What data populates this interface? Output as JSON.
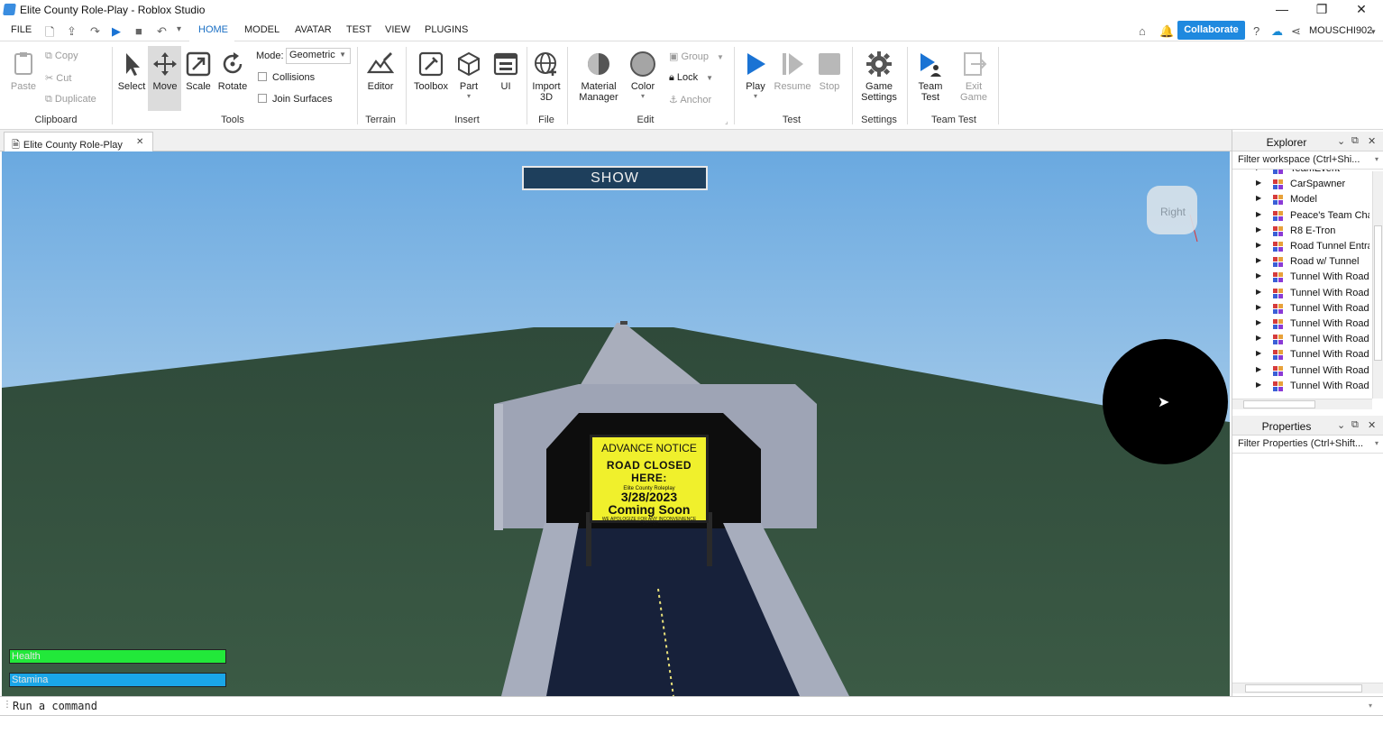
{
  "window": {
    "title": "Elite County Role-Play - Roblox Studio",
    "controls": [
      "—",
      "❐",
      "✕"
    ]
  },
  "menu": {
    "tabs": [
      "FILE",
      "HOME",
      "MODEL",
      "AVATAR",
      "TEST",
      "VIEW",
      "PLUGINS"
    ],
    "active_tab": "HOME",
    "collaborate": "Collaborate",
    "username": "MOUSCHI902"
  },
  "ribbon": {
    "clipboard": {
      "paste": "Paste",
      "copy": "Copy",
      "cut": "Cut",
      "duplicate": "Duplicate",
      "label": "Clipboard"
    },
    "tools": {
      "select": "Select",
      "move": "Move",
      "scale": "Scale",
      "rotate": "Rotate",
      "mode_label": "Mode:",
      "mode_value": "Geometric",
      "collisions": "Collisions",
      "join_surfaces": "Join Surfaces",
      "label": "Tools"
    },
    "terrain": {
      "editor": "Editor",
      "label": "Terrain"
    },
    "insert": {
      "toolbox": "Toolbox",
      "part": "Part",
      "ui": "UI",
      "label": "Insert"
    },
    "file": {
      "import_line1": "Import",
      "import_line2": "3D",
      "label": "File"
    },
    "edit": {
      "material_line1": "Material",
      "material_line2": "Manager",
      "color": "Color",
      "group": "Group",
      "lock": "Lock",
      "anchor": "Anchor",
      "label": "Edit"
    },
    "test": {
      "play": "Play",
      "resume": "Resume",
      "stop": "Stop",
      "label": "Test"
    },
    "settings": {
      "game_line1": "Game",
      "game_line2": "Settings",
      "label": "Settings"
    },
    "teamtest": {
      "team_line1": "Team",
      "team_line2": "Test",
      "exit_line1": "Exit",
      "exit_line2": "Game",
      "label": "Team Test"
    }
  },
  "doc_tab": {
    "label": "Elite County Role-Play",
    "close": "✕"
  },
  "viewport": {
    "show_button": "SHOW",
    "view_cube_label": "Right",
    "health_label": "Health",
    "stamina_label": "Stamina",
    "health_color": "#22e83a",
    "stamina_color": "#1aa6e8",
    "sign": {
      "line1": "ADVANCE NOTICE",
      "line2": "ROAD CLOSED HERE:",
      "line3": "Elite County Roleplay",
      "line4": "3/28/2023",
      "line5": "Coming Soon",
      "line6": "WE APOLOGIZE FOR ANY INCONVENIENCE CAUSED"
    }
  },
  "command_bar": {
    "placeholder": "Run a command"
  },
  "explorer": {
    "title": "Explorer",
    "filter": "Filter workspace (Ctrl+Shi...",
    "items": [
      "TeamEvent",
      "CarSpawner",
      "Model",
      "Peace's Team Char",
      "R8 E-Tron",
      "Road Tunnel Entra",
      "Road w/ Tunnel",
      "Tunnel With Road",
      "Tunnel With Road",
      "Tunnel With Road",
      "Tunnel With Road",
      "Tunnel With Road",
      "Tunnel With Road",
      "Tunnel With Road",
      "Tunnel With Road"
    ]
  },
  "properties": {
    "title": "Properties",
    "filter": "Filter Properties (Ctrl+Shift..."
  }
}
